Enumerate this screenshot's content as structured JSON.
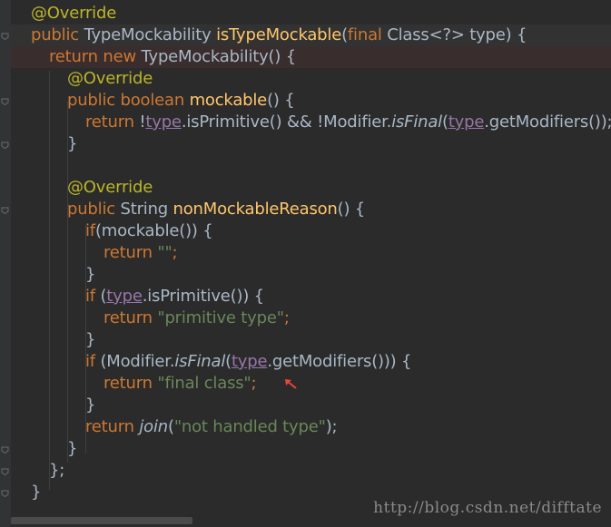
{
  "lines": [
    {
      "indent": 1,
      "tokens": [
        {
          "t": "@Override",
          "c": "ann"
        }
      ]
    },
    {
      "indent": 1,
      "cls": "caret",
      "tokens": [
        {
          "t": "public ",
          "c": "kw"
        },
        {
          "t": "TypeMockability "
        },
        {
          "t": "isTypeMockable",
          "c": "fn"
        },
        {
          "t": "("
        },
        {
          "t": "final ",
          "c": "kw"
        },
        {
          "t": "Class<?> type) {"
        }
      ]
    },
    {
      "indent": 2,
      "cls": "hl",
      "tokens": [
        {
          "t": "return new ",
          "c": "kw"
        },
        {
          "t": "TypeMockability() {"
        }
      ]
    },
    {
      "indent": 3,
      "tokens": [
        {
          "t": "@Override",
          "c": "ann"
        }
      ]
    },
    {
      "indent": 3,
      "tokens": [
        {
          "t": "public boolean ",
          "c": "kw"
        },
        {
          "t": "mockable",
          "c": "fn"
        },
        {
          "t": "() {"
        }
      ]
    },
    {
      "indent": 4,
      "tokens": [
        {
          "t": "return ",
          "c": "kw"
        },
        {
          "t": "!"
        },
        {
          "t": "type",
          "c": "fld"
        },
        {
          "t": ".isPrimitive() && !Modifier."
        },
        {
          "t": "isFinal",
          "c": "it"
        },
        {
          "t": "("
        },
        {
          "t": "type",
          "c": "fld"
        },
        {
          "t": ".getModifiers());"
        }
      ]
    },
    {
      "indent": 3,
      "tokens": [
        {
          "t": "}"
        }
      ]
    },
    {
      "indent": 0,
      "tokens": []
    },
    {
      "indent": 3,
      "tokens": [
        {
          "t": "@Override",
          "c": "ann"
        }
      ]
    },
    {
      "indent": 3,
      "tokens": [
        {
          "t": "public ",
          "c": "kw"
        },
        {
          "t": "String "
        },
        {
          "t": "nonMockableReason",
          "c": "fn"
        },
        {
          "t": "() {"
        }
      ]
    },
    {
      "indent": 4,
      "tokens": [
        {
          "t": "if",
          "c": "kw"
        },
        {
          "t": "(mockable()) {"
        }
      ]
    },
    {
      "indent": 5,
      "tokens": [
        {
          "t": "return ",
          "c": "kw"
        },
        {
          "t": "\"\"",
          "c": "str"
        },
        {
          "t": ";",
          "c": "kw"
        }
      ]
    },
    {
      "indent": 4,
      "tokens": [
        {
          "t": "}"
        }
      ]
    },
    {
      "indent": 4,
      "tokens": [
        {
          "t": "if ",
          "c": "kw"
        },
        {
          "t": "("
        },
        {
          "t": "type",
          "c": "fld"
        },
        {
          "t": ".isPrimitive()) {"
        }
      ]
    },
    {
      "indent": 5,
      "tokens": [
        {
          "t": "return ",
          "c": "kw"
        },
        {
          "t": "\"primitive type\"",
          "c": "str"
        },
        {
          "t": ";",
          "c": "kw"
        }
      ]
    },
    {
      "indent": 4,
      "tokens": [
        {
          "t": "}"
        }
      ]
    },
    {
      "indent": 4,
      "tokens": [
        {
          "t": "if ",
          "c": "kw"
        },
        {
          "t": "(Modifier."
        },
        {
          "t": "isFinal",
          "c": "it"
        },
        {
          "t": "("
        },
        {
          "t": "type",
          "c": "fld"
        },
        {
          "t": ".getModifiers())) {"
        }
      ]
    },
    {
      "indent": 5,
      "tokens": [
        {
          "t": "return ",
          "c": "kw"
        },
        {
          "t": "\"final class\"",
          "c": "str"
        },
        {
          "t": ";",
          "c": "kw"
        }
      ]
    },
    {
      "indent": 4,
      "tokens": [
        {
          "t": "}"
        }
      ]
    },
    {
      "indent": 4,
      "tokens": [
        {
          "t": "return ",
          "c": "kw"
        },
        {
          "t": "join",
          "c": "it"
        },
        {
          "t": "("
        },
        {
          "t": "\"not handled type\"",
          "c": "str"
        },
        {
          "t": ");"
        }
      ]
    },
    {
      "indent": 3,
      "tokens": [
        {
          "t": "}"
        }
      ]
    },
    {
      "indent": 2,
      "tokens": [
        {
          "t": "};"
        }
      ]
    },
    {
      "indent": 1,
      "tokens": [
        {
          "t": "}"
        }
      ]
    }
  ],
  "watermark": "http://blog.csdn.net/difftate",
  "colors": {
    "background": "#2b2b2b",
    "keyword": "#cc7832",
    "annotation": "#bbb529",
    "method": "#ffc66d",
    "string": "#6a8759",
    "field": "#9876aa",
    "text": "#a9b7c6",
    "arrow": "#e8463a"
  },
  "icons": {
    "fold_marker": "fold-marker-icon",
    "annotation_arrow": "red-arrow-icon"
  }
}
